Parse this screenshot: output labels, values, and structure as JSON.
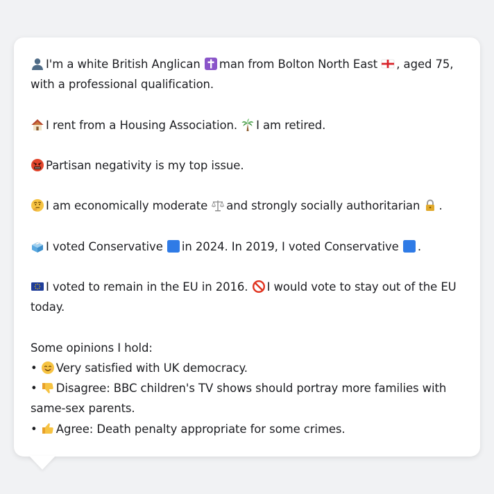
{
  "profile": {
    "identity": {
      "icon": "bust-silhouette-icon",
      "text_before": "I'm a white British Anglican",
      "cross_icon": "latin-cross-icon",
      "text_mid": "man from Bolton North East",
      "flag_icon": "england-flag-icon",
      "text_after": ", aged 75,",
      "line2": "with a professional qualification."
    },
    "housing": {
      "icon": "house-icon",
      "text1": "I rent from a Housing Association.",
      "palm_icon": "palm-tree-icon",
      "text2": "I am retired."
    },
    "issue": {
      "icon": "angry-face-icon",
      "text": "Partisan negativity is my top issue."
    },
    "ideology": {
      "icon": "thinking-face-icon",
      "text1": "I am economically moderate",
      "scales_icon": "balance-scale-icon",
      "text2": "and strongly socially authoritarian",
      "lock_icon": "padlock-icon",
      "end": "."
    },
    "vote": {
      "icon": "ballot-box-icon",
      "text1": "I voted Conservative",
      "text2": "in 2024. In 2019, I voted Conservative",
      "end": ".",
      "party_color": "#2f7be6"
    },
    "eu": {
      "icon": "eu-flag-icon",
      "text1": "I voted to remain in the EU in 2016.",
      "prohibited_icon": "prohibited-icon",
      "text2": "I would vote to stay out of the EU",
      "line2": "today."
    },
    "opinions": {
      "heading": "Some opinions I hold:",
      "items": [
        {
          "bullet": "•",
          "icon": "smiling-face-icon",
          "text": "Very satisfied with UK democracy."
        },
        {
          "bullet": "•",
          "icon": "thumbs-down-icon",
          "text": "Disagree: BBC children's TV shows should portray more families with",
          "text2": "same-sex parents."
        },
        {
          "bullet": "•",
          "icon": "thumbs-up-icon",
          "text": "Agree: Death penalty appropriate for some crimes."
        }
      ]
    }
  }
}
